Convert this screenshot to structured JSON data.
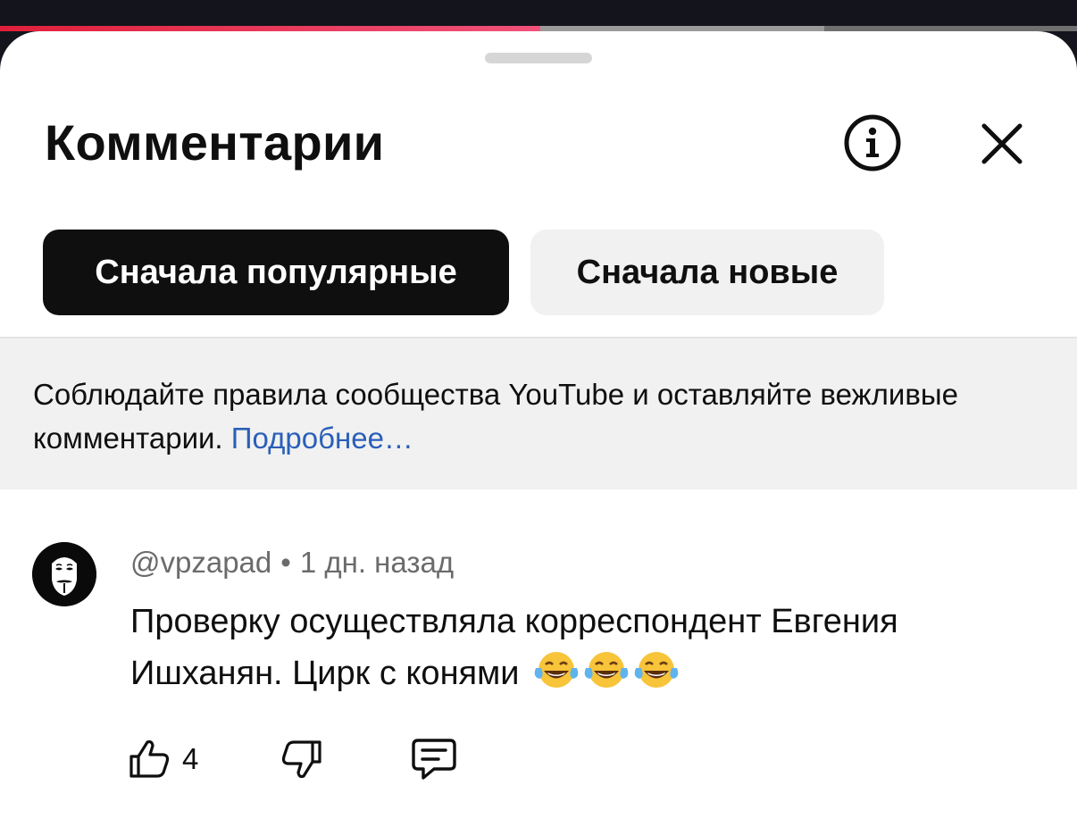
{
  "video_progress": {
    "played_fraction": 0.502,
    "buffered_fraction": 0.765,
    "played_color": "#e0203a"
  },
  "header": {
    "title": "Комментарии",
    "info_icon": "info-icon",
    "close_icon": "close-icon"
  },
  "sort_chips": [
    {
      "label": "Сначала популярные",
      "selected": true
    },
    {
      "label": "Сначала новые",
      "selected": false
    }
  ],
  "notice": {
    "text": "Соблюдайте правила сообщества YouTube и оставляйте вежливые комментарии.",
    "link": "Подробнее…",
    "link_color": "#2a5fb8"
  },
  "comments": [
    {
      "avatar_icon": "guy-fawkes-mask-avatar",
      "author": "@vpzapad",
      "separator": "•",
      "time": "1 дн. назад",
      "text": "Проверку осуществляла корреспондент Евгения Ишханян. Цирк с конями",
      "emojis": [
        "tears-of-joy-emoji",
        "tears-of-joy-emoji",
        "tears-of-joy-emoji"
      ],
      "likes": "4",
      "like_icon": "thumbs-up-icon",
      "dislike_icon": "thumbs-down-icon",
      "reply_icon": "reply-comment-icon"
    }
  ]
}
